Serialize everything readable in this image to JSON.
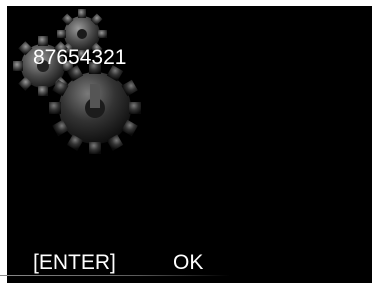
{
  "display": {
    "value": "87654321",
    "background_color": "#000000",
    "text_color": "#ffffff"
  },
  "softkeys": {
    "left_label": "[ENTER]",
    "right_label": "OK"
  },
  "decoration": {
    "icon": "gears-icon"
  }
}
